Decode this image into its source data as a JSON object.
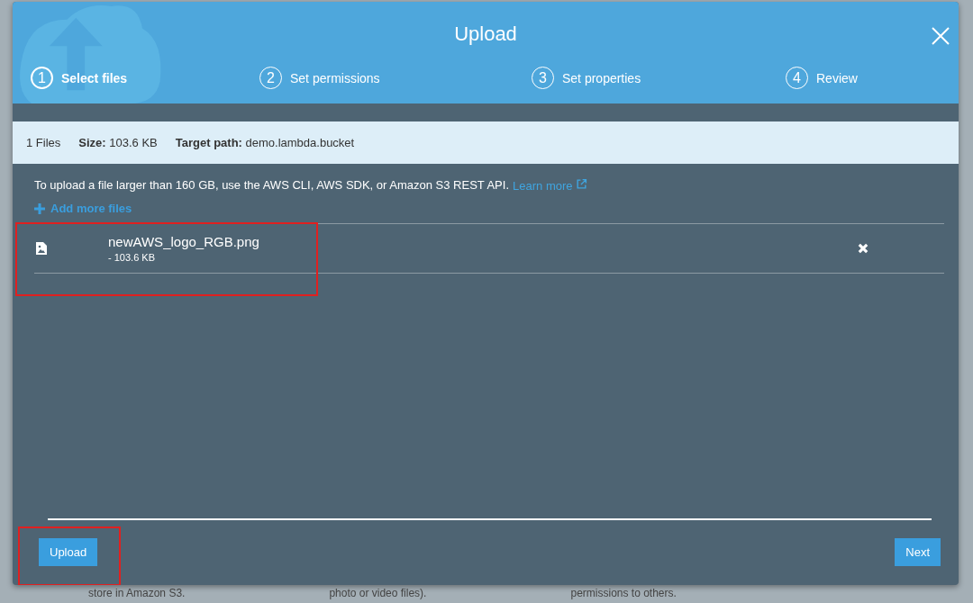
{
  "dialog": {
    "title": "Upload",
    "steps": [
      {
        "number": "1",
        "label": "Select files",
        "selected": true
      },
      {
        "number": "2",
        "label": "Set permissions",
        "selected": false
      },
      {
        "number": "3",
        "label": "Set properties",
        "selected": false
      },
      {
        "number": "4",
        "label": "Review",
        "selected": false
      }
    ],
    "summary": {
      "count": "1 Files",
      "size_label": "Size:",
      "size": "103.6 KB",
      "path_label": "Target path:",
      "path": "demo.lambda.bucket"
    },
    "notice": "To upload a file larger than 160 GB, use the AWS CLI, AWS SDK, or Amazon S3 REST API.",
    "learn_more": "Learn more",
    "add_more": "Add more files",
    "files": [
      {
        "name": "newAWS_logo_RGB.png",
        "size": "- 103.6 KB"
      }
    ],
    "buttons": {
      "upload": "Upload",
      "next": "Next"
    }
  },
  "background_texts": [
    "store in Amazon S3.",
    "photo or video files).",
    "permissions to others."
  ]
}
